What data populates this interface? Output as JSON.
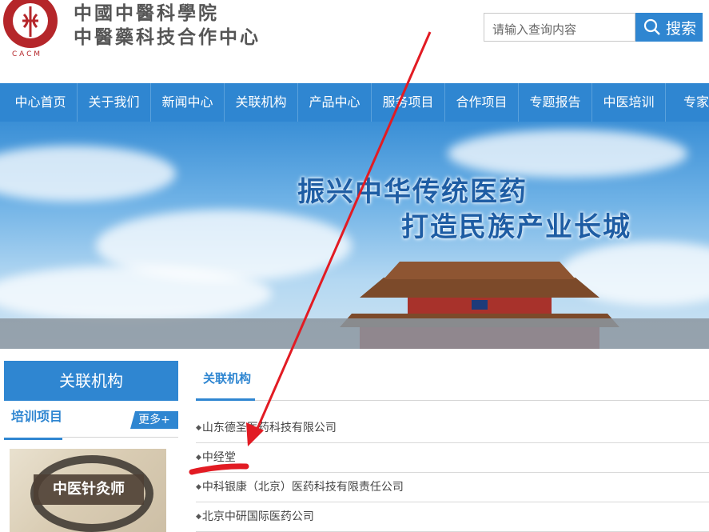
{
  "header": {
    "logo_text": "CACM",
    "org_name_1": "中國中醫科學院",
    "org_name_2": "中醫藥科技合作中心",
    "search_placeholder": "请输入查询内容",
    "search_button": "搜索"
  },
  "nav": {
    "items": [
      "中心首页",
      "关于我们",
      "新闻中心",
      "关联机构",
      "产品中心",
      "服务项目",
      "合作项目",
      "专题报告",
      "中医培训",
      "专家介"
    ]
  },
  "banner": {
    "line1": "振兴中华传统医药",
    "line2": "打造民族产业长城"
  },
  "sidebar": {
    "title": "关联机构",
    "tab": "培训项目",
    "more": "更多+",
    "training_label": "中医针灸师"
  },
  "main": {
    "tab": "关联机构",
    "items": [
      "山东德圣医药科技有限公司",
      "中经堂",
      "中科银康（北京）医药科技有限责任公司",
      "北京中研国际医药公司"
    ]
  },
  "colors": {
    "accent": "#2f86d1",
    "annotation": "#e21b23"
  }
}
